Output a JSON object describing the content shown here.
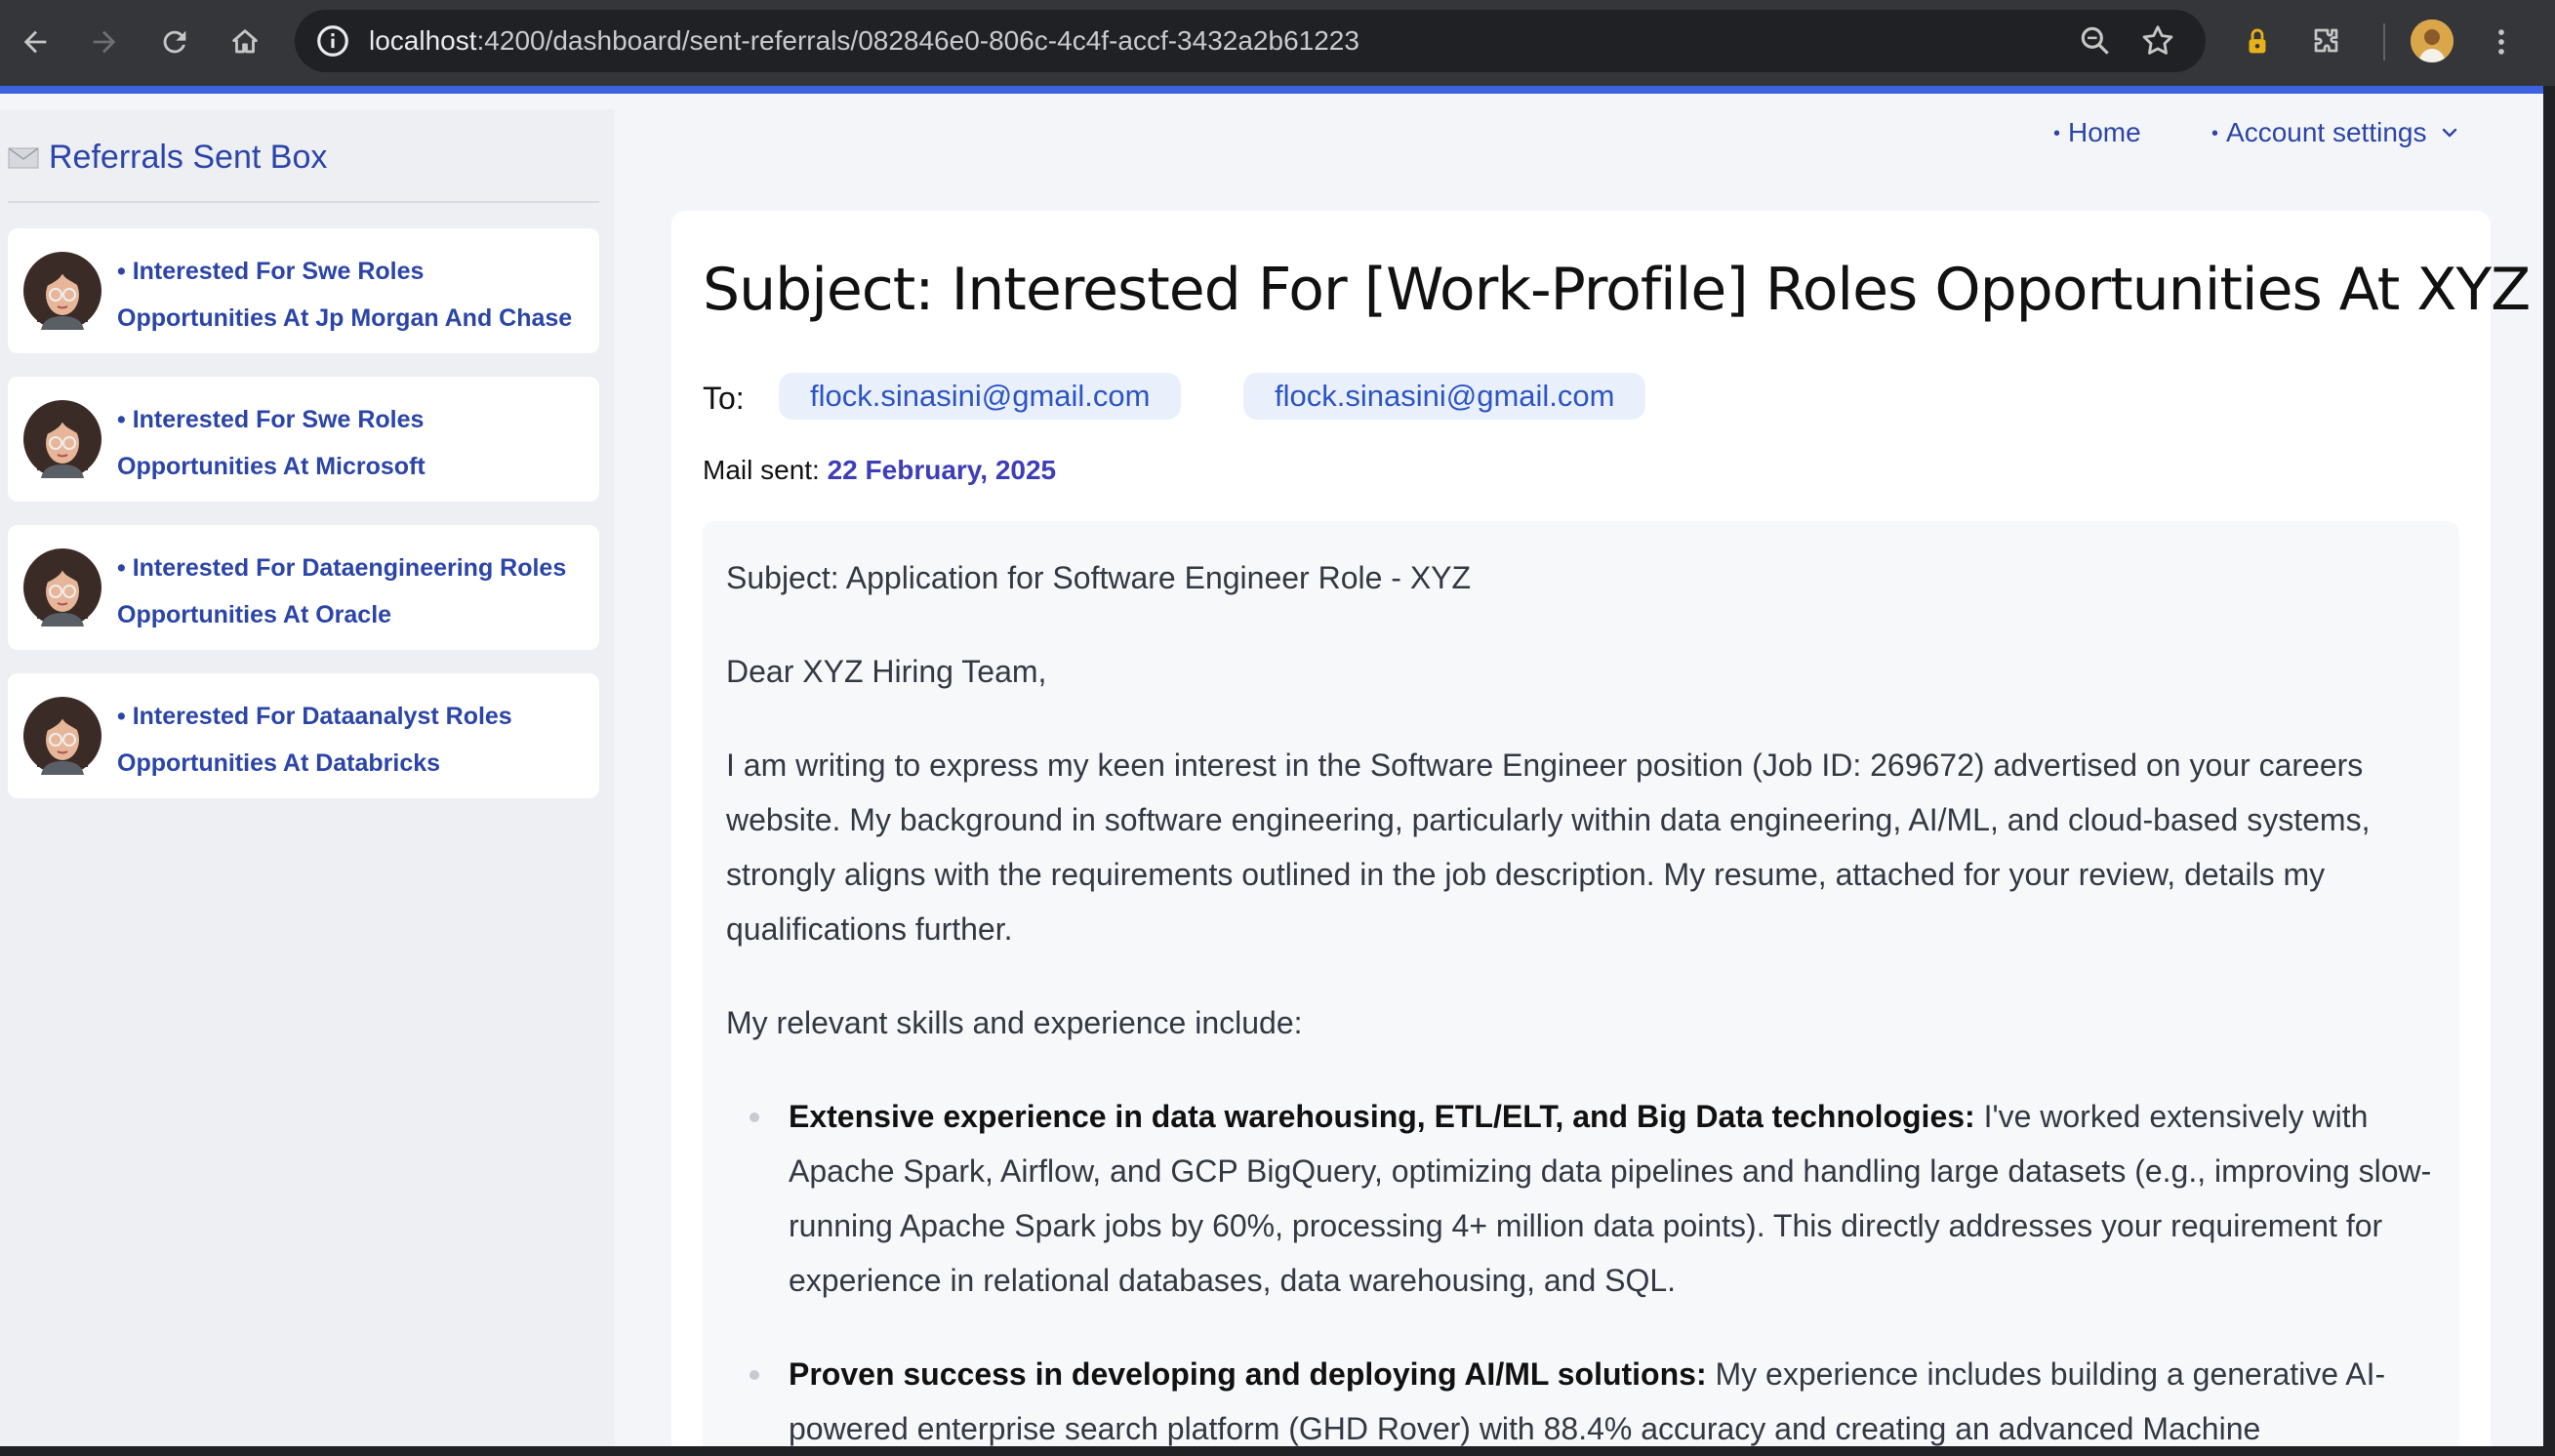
{
  "browser": {
    "url_host": "localhost",
    "url_path": ":4200/dashboard/sent-referrals/082846e0-806c-4c4f-accf-3432a2b61223"
  },
  "sidebar": {
    "title": "Referrals Sent Box",
    "items": [
      {
        "label": "• Interested For Swe Roles Opportunities At Jp Morgan And Chase"
      },
      {
        "label": "• Interested For Swe Roles Opportunities At Microsoft"
      },
      {
        "label": "• Interested For Dataengineering Roles Opportunities At Oracle"
      },
      {
        "label": "• Interested For Dataanalyst Roles Opportunities At Databricks"
      }
    ]
  },
  "topnav": {
    "home": "Home",
    "account": "Account settings"
  },
  "mail": {
    "subject": "Subject: Interested For [Work-Profile] Roles Opportunities At XYZ",
    "to_label": "To:",
    "recipients": [
      "flock.sinasini@gmail.com",
      "flock.sinasini@gmail.com"
    ],
    "sent_label": "Mail sent:",
    "sent_date": "22 February, 2025",
    "body": {
      "subject_line": "Subject: Application for Software Engineer Role - XYZ",
      "greeting": "Dear XYZ Hiring Team,",
      "intro": "I am writing to express my keen interest in the Software Engineer position (Job ID: 269672) advertised on your careers website. My background in software engineering, particularly within data engineering, AI/ML, and cloud-based systems, strongly aligns with the requirements outlined in the job description. My resume, attached for your review, details my qualifications further.",
      "skills_intro": "My relevant skills and experience include:",
      "bullets": [
        {
          "title": "Extensive experience in data warehousing, ETL/ELT, and Big Data technologies:",
          "text": " I've worked extensively with Apache Spark, Airflow, and GCP BigQuery, optimizing data pipelines and handling large datasets (e.g., improving slow-running Apache Spark jobs by 60%, processing 4+ million data points). This directly addresses your requirement for experience in relational databases, data warehousing, and SQL."
        },
        {
          "title": "Proven success in developing and deploying AI/ML solutions:",
          "text": " My experience includes building a generative AI-powered enterprise search platform (GHD Rover) with 88.4% accuracy and creating an advanced Machine"
        }
      ]
    }
  },
  "colors": {
    "link": "#2b45a8",
    "chrome": "#35363a",
    "load_bar": "#3b62e0"
  }
}
